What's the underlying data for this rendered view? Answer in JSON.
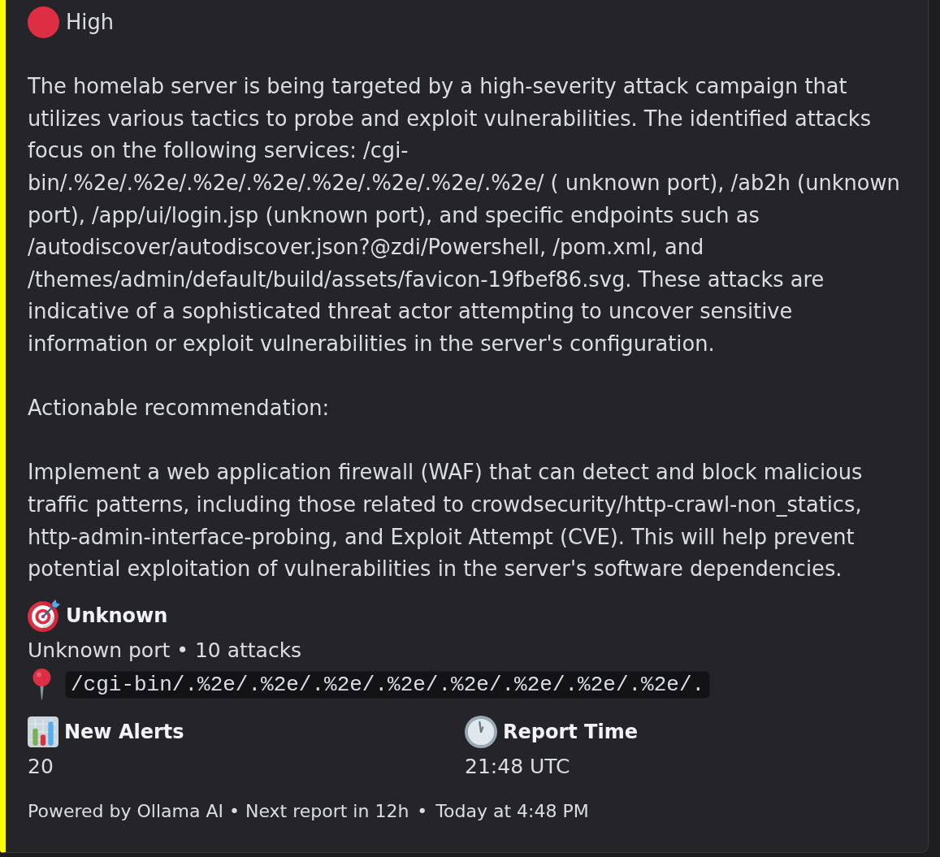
{
  "embed": {
    "severity": {
      "label": "High"
    },
    "description": [
      "The homelab server is being targeted by a high-severity attack campaign that utilizes various tactics to probe and exploit vulnerabilities. The identified attacks focus on the following services: /cgi-bin/.%2e/.%2e/.%2e/.%2e/.%2e/.%2e/.%2e/.%2e/ ( unknown port), /ab2h (unknown port), /app/ui/login.jsp (unknown port), and specific endpoints such as /autodiscover/autodiscover.json?@zdi/Powershell, /pom.xml, and /themes/admin/default/build/assets/favicon-19fbef86.svg. These attacks are indicative of a sophisticated threat actor attempting to uncover sensitive information or exploit vulnerabilities in the server's configuration.",
      "Actionable recommendation:",
      "Implement a web application firewall (WAF) that can detect and block malicious traffic patterns, including those related to crowdsecurity/http-crawl-non_statics, http-admin-interface-probing, and Exploit Attempt (CVE). This will help prevent potential exploitation of vulnerabilities in the server's software dependencies."
    ],
    "target_field": {
      "title": "Unknown",
      "detail": "Unknown port • 10 attacks",
      "path": "/cgi-bin/.%2e/.%2e/.%2e/.%2e/.%2e/.%2e/.%2e/.%2e/."
    },
    "stat_fields": [
      {
        "kind": "chart",
        "title": "New Alerts",
        "value": "20"
      },
      {
        "kind": "clock",
        "title": "Report Time",
        "value": "21:48 UTC"
      }
    ],
    "footer": {
      "text": "Powered by Ollama AI • Next report in 12h",
      "separator": "•",
      "timestamp": "Today at 4:48 PM"
    }
  }
}
